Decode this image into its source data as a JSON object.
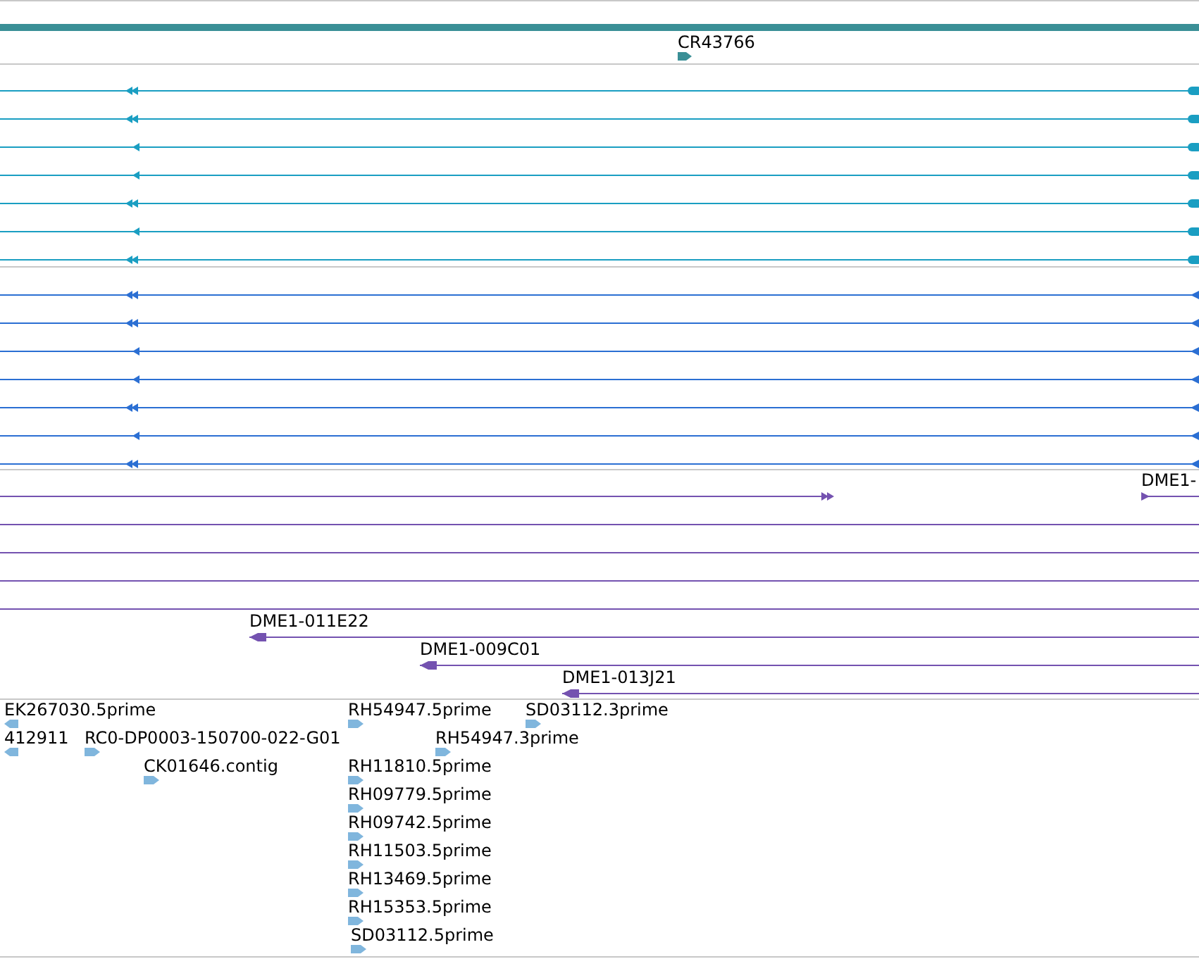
{
  "tracks": [
    {
      "kind": "gene",
      "color": "#3a8f96",
      "features": [
        {
          "label": "CR43766"
        }
      ]
    },
    {
      "kind": "transcript",
      "color": "#1a9ec2"
    },
    {
      "kind": "transcript",
      "color": "#2b6fd3"
    },
    {
      "kind": "clone",
      "color": "#7452b0",
      "features": [
        {
          "label": "DME1-"
        },
        {
          "label": "DME1-011E22"
        },
        {
          "label": "DME1-009C01"
        },
        {
          "label": "DME1-013J21"
        }
      ]
    },
    {
      "kind": "est",
      "color": "#80b6dd",
      "features": [
        {
          "label": "EK267030.5prime"
        },
        {
          "label": "RH54947.5prime"
        },
        {
          "label": "SD03112.3prime"
        },
        {
          "label": "412911"
        },
        {
          "label": "RC0-DP0003-150700-022-G01"
        },
        {
          "label": "RH54947.3prime"
        },
        {
          "label": "CK01646.contig"
        },
        {
          "label": "RH11810.5prime"
        },
        {
          "label": "RH09779.5prime"
        },
        {
          "label": "RH09742.5prime"
        },
        {
          "label": "RH11503.5prime"
        },
        {
          "label": "RH13469.5prime"
        },
        {
          "label": "RH15353.5prime"
        },
        {
          "label": "SD03112.5prime"
        }
      ]
    }
  ]
}
